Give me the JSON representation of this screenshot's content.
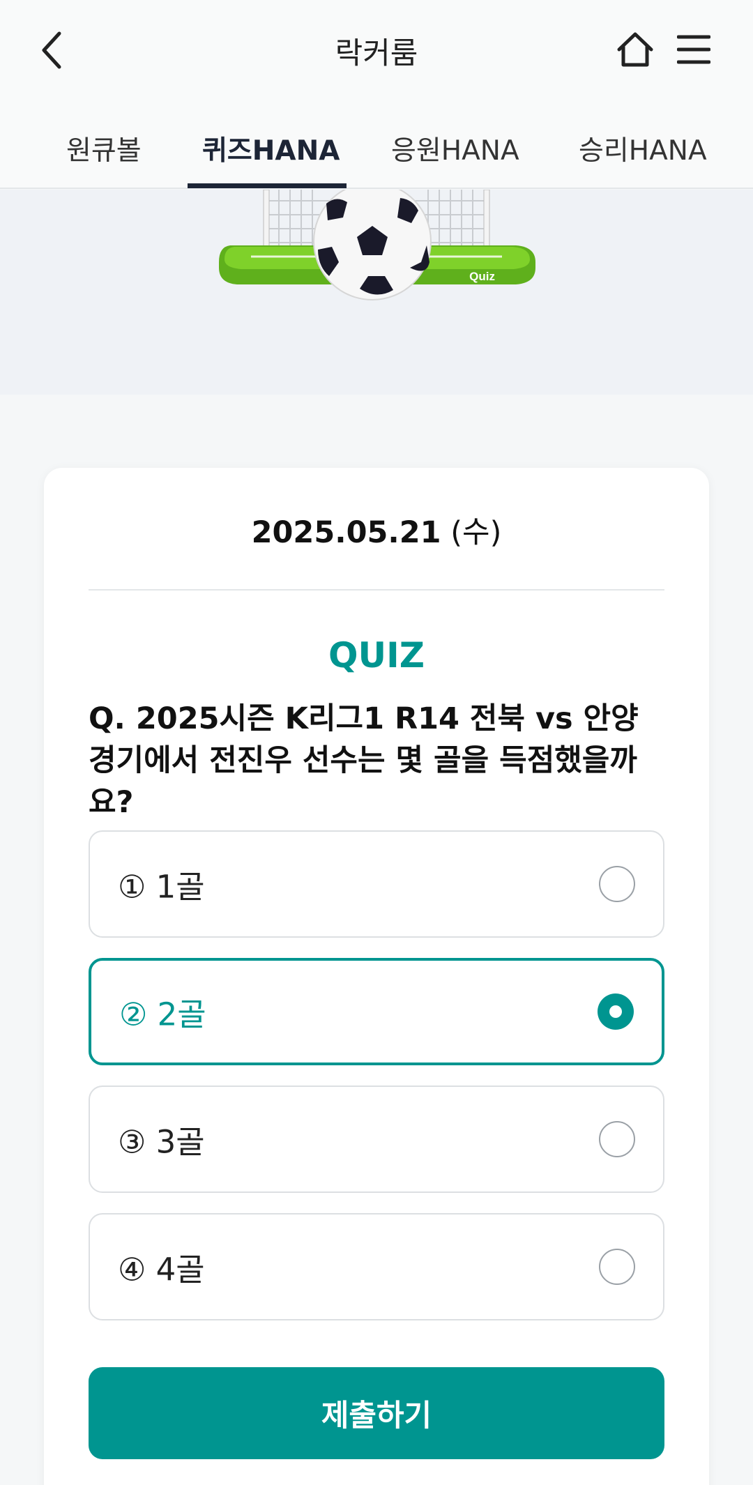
{
  "header": {
    "title": "락커룸",
    "icons": {
      "back": "chevron-left-icon",
      "home": "home-icon",
      "menu": "hamburger-menu-icon"
    }
  },
  "tabs": [
    {
      "label": "원큐볼",
      "active": false
    },
    {
      "label": "퀴즈HANA",
      "active": true
    },
    {
      "label": "응원HANA",
      "active": false
    },
    {
      "label": "승리HANA",
      "active": false
    }
  ],
  "banner": {
    "goal_text": "Quiz"
  },
  "quiz": {
    "date": "2025.05.21",
    "weekday": "(수)",
    "label": "QUIZ",
    "question": "Q. 2025시즌 K리그1 R14 전북 vs 안양 경기에서 전진우 선수는 몇 골을 득점했을까요?",
    "options": [
      {
        "label": "① 1골",
        "selected": false
      },
      {
        "label": "② 2골",
        "selected": true
      },
      {
        "label": "③ 3골",
        "selected": false
      },
      {
        "label": "④ 4골",
        "selected": false
      }
    ],
    "submit_label": "제출하기"
  },
  "colors": {
    "accent": "#009590",
    "tab_active": "#1d2536",
    "banner_bg": "#eff2f6"
  }
}
